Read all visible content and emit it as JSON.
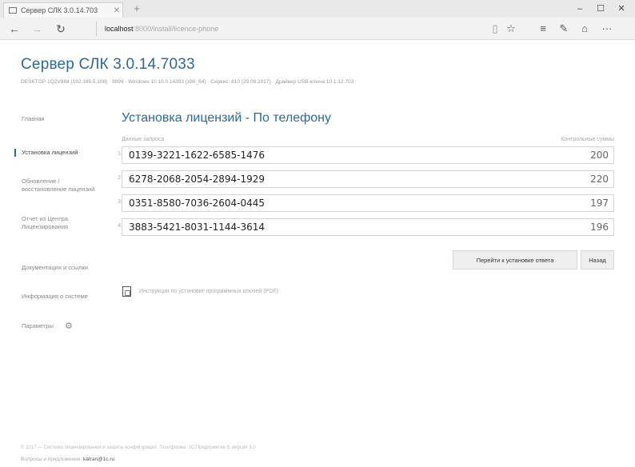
{
  "browser": {
    "tab_title": "Сервер СЛК 3.0.14.703",
    "tab_close": "✕",
    "new_tab": "+",
    "window_buttons": {
      "minimize": "–",
      "maximize": "☐",
      "close": "✕"
    },
    "nav": {
      "back": "←",
      "forward": "→",
      "refresh": "↻"
    },
    "address": {
      "host": "localhost",
      "path": ":8000/install/licence-phone"
    },
    "toolbar": {
      "reading": "▯",
      "favorite": "☆",
      "hub": "≡",
      "notes": "✎",
      "share": "⌂",
      "more": "···"
    }
  },
  "app": {
    "title": "Сервер СЛК 3.0.14.7033",
    "subinfo": "DESKTOP-1Q2V8IM (192.168.5.108) · 9999 · Windows 10 10.0.14393 (x86_64) · Сервис: 810 (29.08.2017) · Драйвер USB-ключа 10.1.12.703"
  },
  "sidebar": {
    "items": [
      {
        "label": "Главная"
      },
      {
        "label": "Установка лицензий"
      },
      {
        "label": "Обновление / восстановление лицензий"
      },
      {
        "label": "Отчет из Центра Лицензирования"
      },
      {
        "label": "Документация и ссылки"
      },
      {
        "label": "Информация о системе"
      },
      {
        "label": "Параметры"
      }
    ],
    "gear_glyph": "⚙"
  },
  "main": {
    "title": "Установка лицензий - По телефону",
    "col_request": "Данные запроса",
    "col_checksums": "Контрольные суммы",
    "rows": [
      {
        "num": "1",
        "code": "0139-3221-1622-6585-1476",
        "sum": "200"
      },
      {
        "num": "2",
        "code": "6278-2068-2054-2894-1929",
        "sum": "220"
      },
      {
        "num": "3",
        "code": "0351-8580-7036-2604-0445",
        "sum": "197"
      },
      {
        "num": "4",
        "code": "3883-5421-8031-1144-3614",
        "sum": "196"
      }
    ],
    "btn_go": "Перейти к установке ответа",
    "btn_back": "Назад",
    "pdf_link": "Инструкция по установке программных ключей (PDF)"
  },
  "footer": {
    "line1": "© 2017 — Система лицензирования и защиты конфигураций. Платформа: 1С:Предприятие 8, версия 3.0",
    "line2_prefix": "Вопросы и предложения:",
    "email": "katran@1c.ru"
  }
}
